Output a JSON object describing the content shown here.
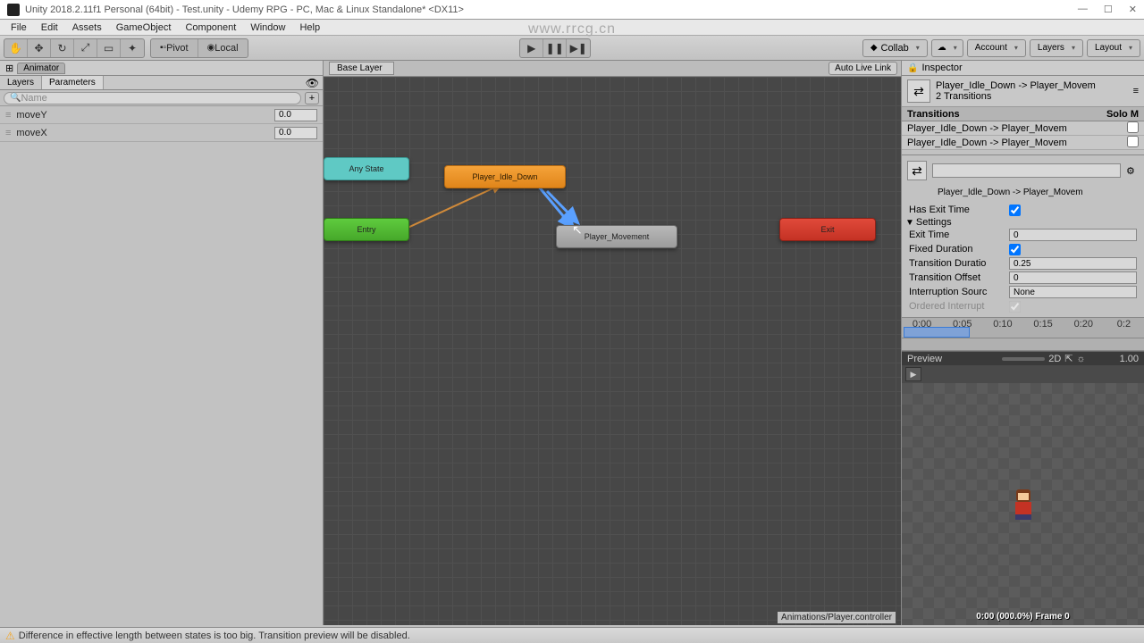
{
  "titlebar": {
    "text": "Unity 2018.2.11f1 Personal (64bit) - Test.unity - Udemy RPG - PC, Mac & Linux Standalone* <DX11>"
  },
  "menubar": [
    "File",
    "Edit",
    "Assets",
    "GameObject",
    "Component",
    "Window",
    "Help"
  ],
  "toolbar": {
    "pivot": "Pivot",
    "local": "Local",
    "collab": "Collab",
    "account": "Account",
    "layers": "Layers",
    "layout": "Layout"
  },
  "animator": {
    "tab": "Animator",
    "sub_tabs": {
      "layers": "Layers",
      "parameters": "Parameters"
    },
    "search_placeholder": "Name",
    "params": [
      {
        "name": "moveY",
        "value": "0.0"
      },
      {
        "name": "moveX",
        "value": "0.0"
      }
    ]
  },
  "graph": {
    "breadcrumb": "Base Layer",
    "auto_live": "Auto Live Link",
    "nodes": {
      "any_state": "Any State",
      "entry": "Entry",
      "idle": "Player_Idle_Down",
      "movement": "Player_Movement",
      "exit": "Exit"
    },
    "asset_path": "Animations/Player.controller"
  },
  "inspector": {
    "tab": "Inspector",
    "title": "Player_Idle_Down -> Player_Movem",
    "subtitle": "2 Transitions",
    "transitions_hdr": "Transitions",
    "solo_m": "Solo  M",
    "trans_list": [
      "Player_Idle_Down -> Player_Movem",
      "Player_Idle_Down -> Player_Movem"
    ],
    "name_field": "",
    "name_sub": "Player_Idle_Down -> Player_Movem",
    "has_exit_time": "Has Exit Time",
    "settings": "Settings",
    "exit_time": {
      "label": "Exit Time",
      "value": "0"
    },
    "fixed_duration": "Fixed Duration",
    "trans_duration": {
      "label": "Transition Duratio",
      "value": "0.25"
    },
    "trans_offset": {
      "label": "Transition Offset",
      "value": "0"
    },
    "interruption": {
      "label": "Interruption Sourc",
      "value": "None"
    },
    "ordered": "Ordered Interrupt",
    "timeline_ticks": [
      "0:00",
      "0:05",
      "0:10",
      "0:15",
      "0:20",
      "0:2"
    ]
  },
  "preview": {
    "label": "Preview",
    "mode_2d": "2D",
    "speed": "1.00",
    "status": "0:00 (000.0%) Frame 0"
  },
  "statusbar": {
    "warning": "Difference in effective length between states is too big. Transition preview will be disabled."
  },
  "watermark": "www.rrcg.cn"
}
